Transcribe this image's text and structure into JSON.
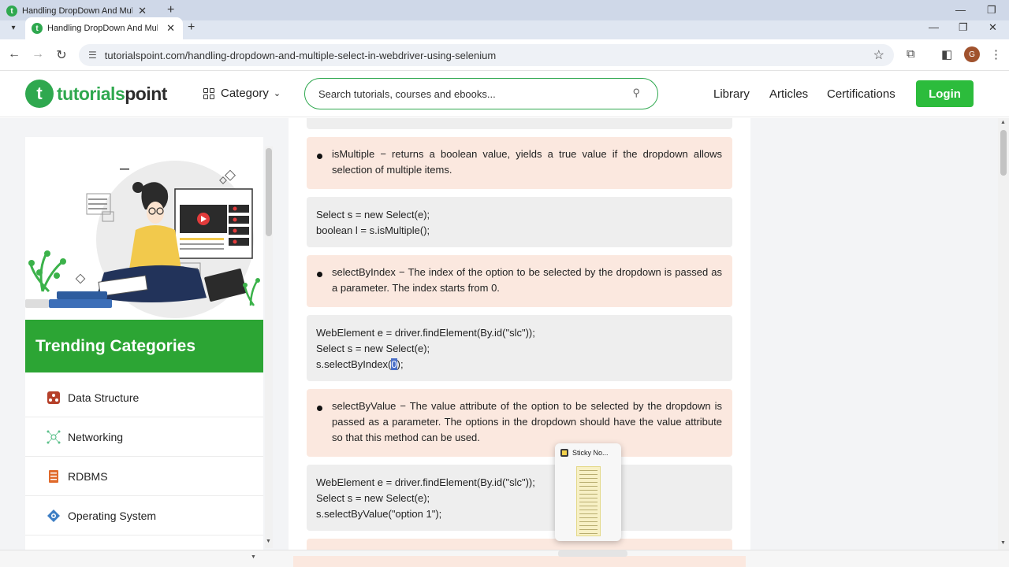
{
  "browser": {
    "tabs": [
      {
        "title": "Handling DropDown And Multi"
      },
      {
        "title": "Handling DropDown And Multi"
      }
    ],
    "url": "tutorialspoint.com/handling-dropdown-and-multiple-select-in-webdriver-using-selenium",
    "avatar_letter": "G"
  },
  "header": {
    "logo_brand": "tutorials",
    "logo_brand_dark": "point",
    "category_label": "Category",
    "search_placeholder": "Search tutorials, courses and ebooks...",
    "nav": [
      "Library",
      "Articles",
      "Certifications"
    ],
    "login_label": "Login"
  },
  "sidebar": {
    "trending_title": "Trending Categories",
    "categories": [
      {
        "label": "Data Structure",
        "icon": "data-structure-icon"
      },
      {
        "label": "Networking",
        "icon": "networking-icon"
      },
      {
        "label": "RDBMS",
        "icon": "rdbms-icon"
      },
      {
        "label": "Operating System",
        "icon": "operating-system-icon"
      }
    ]
  },
  "content": {
    "blocks": [
      {
        "type": "note",
        "text": "isMultiple − returns a boolean value, yields a true value if the dropdown allows selection of multiple items."
      },
      {
        "type": "code",
        "lines": [
          "Select s = new Select(e);",
          "boolean l = s.isMultiple();"
        ]
      },
      {
        "type": "note",
        "text": "selectByIndex − The index of the option to be selected by the dropdown is passed as a parameter. The index starts from 0."
      },
      {
        "type": "code",
        "lines": [
          "WebElement e = driver.findElement(By.id(\"slc\"));",
          "Select s = new Select(e);"
        ],
        "last_line_before": "s.selectByIndex(",
        "last_line_selected": "0",
        "last_line_after": ");"
      },
      {
        "type": "note",
        "text": "selectByValue − The value attribute of the option to be selected by the dropdown is passed as a parameter. The options in the dropdown should have the value attribute so that this method can be used."
      },
      {
        "type": "code",
        "lines": [
          "WebElement e = driver.findElement(By.id(\"slc\"));",
          "Select s = new Select(e);",
          "s.selectByValue(\"option 1\");"
        ]
      }
    ]
  },
  "popup": {
    "title": "Sticky No..."
  },
  "colors": {
    "brand_green": "#2fa84f",
    "login_green": "#2cbc3c",
    "note_bg": "#fbe8df",
    "code_bg": "#eeeeee"
  }
}
